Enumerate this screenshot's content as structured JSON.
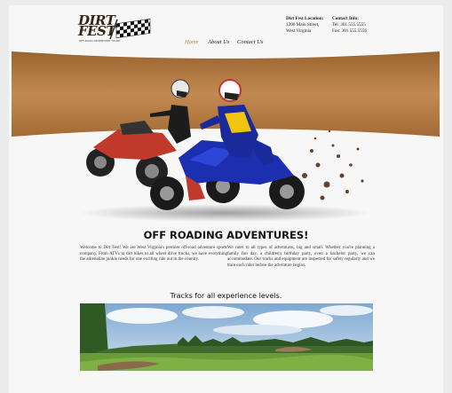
{
  "brand": {
    "logo_line1": "DIRT",
    "logo_line2": "FEST",
    "logo_tagline": "OFF-ROAD ADVENTURE TOURS"
  },
  "location": {
    "heading": "Dirt Fest Location:",
    "line1": "1200 Main Street,",
    "line2": "West Virginia"
  },
  "contact": {
    "heading": "Contact Info:",
    "tel": "Tel: 301.555.5555",
    "fax": "Fax: 301.555.5556"
  },
  "nav": {
    "items": [
      "Home",
      "About Us",
      "Contact Us"
    ],
    "active": "Home"
  },
  "main": {
    "title": "OFF ROADING ADVENTURES!",
    "paragraph1": "Welcome to Dirt Fest! We are West Virginia's premier off-road adventure sports company. From ATVs to dirt bikes to all wheel drive trucks, we have everything the adrenaline junkie needs for one exciting ride out in the country.",
    "paragraph2": "We cater to all types of adventures, big and small. Whether you're planning a family fun day, a children's birthday party, even a bachelor party, we can accommodate. Our tracks and equipment are inspected for safety regularly and we train each rider before the adventure begins.",
    "tracks_title": "Tracks for all experience levels."
  },
  "colors": {
    "hero_band": "#b07a42",
    "nav_active": "#b8844e",
    "atv_blue": "#1b2fb0",
    "atv_red": "#c0392b"
  }
}
